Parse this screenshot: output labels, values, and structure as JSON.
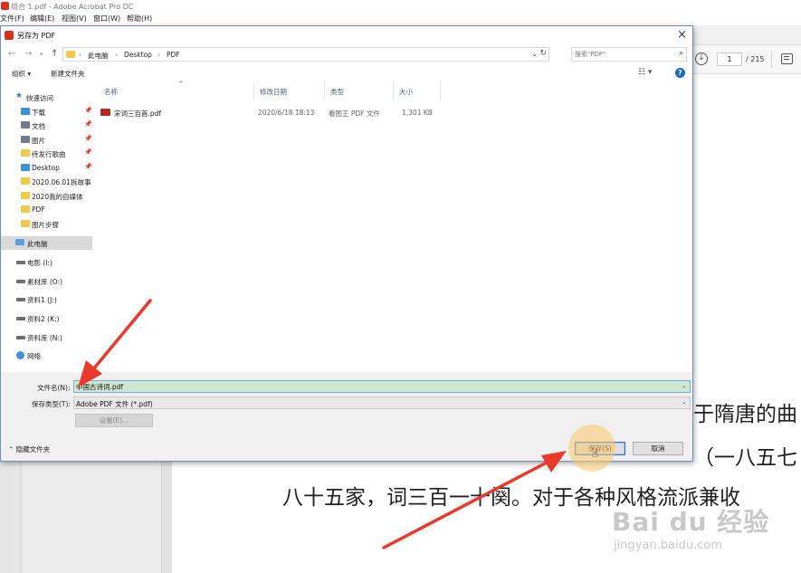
{
  "acrobat": {
    "title": "组合 1.pdf - Adobe Acrobat Pro DC",
    "menu": [
      "文件(F)",
      "编辑(E)",
      "视图(V)",
      "窗口(W)",
      "帮助(H)"
    ],
    "page_current": "1",
    "page_total": "/ 215",
    "doc_lines": [
      "于隋唐的曲",
      "（一八五七",
      "八十五家，词三百一十阕。对于各种风格流派兼收"
    ],
    "watermark": "Bai du 经验",
    "watermark_url": "jingyan.baidu.com"
  },
  "dialog": {
    "title": "另存为 PDF",
    "close": "×",
    "breadcrumb": [
      "此电脑",
      "Desktop",
      "PDF"
    ],
    "search_placeholder": "搜索\"PDF\"",
    "organize": "组织 ▾",
    "new_folder": "新建文件夹",
    "help": "?",
    "sidebar": [
      {
        "label": "快速访问",
        "icon": "star-icon",
        "pin": false
      },
      {
        "label": "下载",
        "icon": "download-icon",
        "pin": true
      },
      {
        "label": "文档",
        "icon": "document-icon",
        "pin": true
      },
      {
        "label": "图片",
        "icon": "picture-icon",
        "pin": true
      },
      {
        "label": "待发行歌曲",
        "icon": "folder-icon",
        "pin": true
      },
      {
        "label": "Desktop",
        "icon": "desktop-icon",
        "pin": true
      },
      {
        "label": "2020.06.01拆故事",
        "icon": "folder-icon",
        "pin": false
      },
      {
        "label": "2020我的自媒体",
        "icon": "folder-icon",
        "pin": false
      },
      {
        "label": "PDF",
        "icon": "folder-icon",
        "pin": false
      },
      {
        "label": "图片步骤",
        "icon": "folder-icon",
        "pin": false
      },
      {
        "label": "此电脑",
        "icon": "computer-icon",
        "pin": false
      },
      {
        "label": "电影 (I:)",
        "icon": "drive-icon",
        "pin": false
      },
      {
        "label": "素材库 (O:)",
        "icon": "drive-icon",
        "pin": false
      },
      {
        "label": "资料1 (J:)",
        "icon": "drive-icon",
        "pin": false
      },
      {
        "label": "资料2 (K:)",
        "icon": "drive-icon",
        "pin": false
      },
      {
        "label": "资料库 (N:)",
        "icon": "drive-icon",
        "pin": false
      },
      {
        "label": "网络",
        "icon": "network-icon",
        "pin": false
      }
    ],
    "columns": [
      "名称",
      "修改日期",
      "类型",
      "大小"
    ],
    "files": [
      {
        "name": "宋词三百首.pdf",
        "modified": "2020/6/18 18:13",
        "type": "看图王 PDF 文件",
        "size": "1,301 KB"
      }
    ],
    "filename_label": "文件名(N):",
    "filename_value": "中国古诗词.pdf",
    "filetype_label": "保存类型(T):",
    "filetype_value": "Adobe PDF 文件 (*.pdf)",
    "settings": "设置(E)...",
    "hide_folders": "隐藏文件夹",
    "save": "保存(S)",
    "cancel": "取消"
  },
  "colors": {
    "annotation_arrow": "#e8392b",
    "selection": "#d9d9d9",
    "filename_highlight": "#cfe6cf"
  }
}
